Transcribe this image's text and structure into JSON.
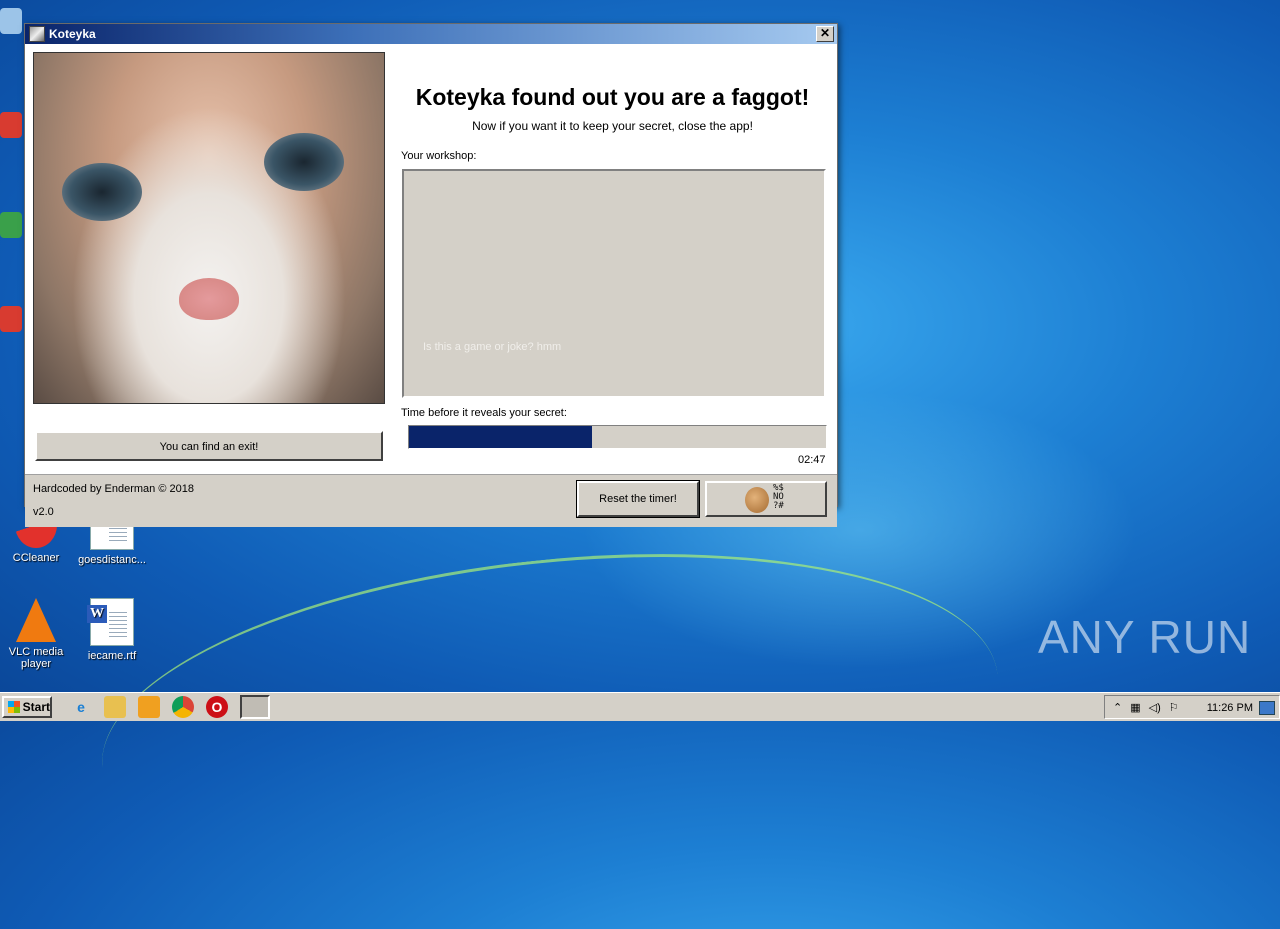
{
  "desktop": {
    "icons": [
      {
        "label": "CCleaner"
      },
      {
        "label": "goesdistanc..."
      },
      {
        "label": "VLC media player"
      },
      {
        "label": "iecame.rtf"
      }
    ],
    "watermark": "ANY RUN"
  },
  "window": {
    "title": "Koteyka",
    "close_glyph": "✕",
    "headline": "Koteyka found out you are a faggot!",
    "subline": "Now if you want it to keep your secret, close the app!",
    "workshop_label": "Your workshop:",
    "workshop_text": "Is this a game or joke? hmm",
    "timer_label": "Time before it reveals your secret:",
    "progress_fraction": 0.44,
    "timer_value": "02:47",
    "exit_button": "You can find an exit!",
    "credit": "Hardcoded by Enderman © 2018",
    "version": "v2.0",
    "reset_button": "Reset the timer!",
    "baldi_scribble": "%$\nNO\n?#"
  },
  "taskbar": {
    "start_label": "Start",
    "pinned": [
      "ie-icon",
      "explorer-icon",
      "media-player-icon",
      "chrome-icon",
      "opera-icon"
    ],
    "tray": {
      "clock": "11:26 PM"
    }
  },
  "colors": {
    "progress_fill": "#0a246a",
    "window_face": "#d4d0c8"
  }
}
